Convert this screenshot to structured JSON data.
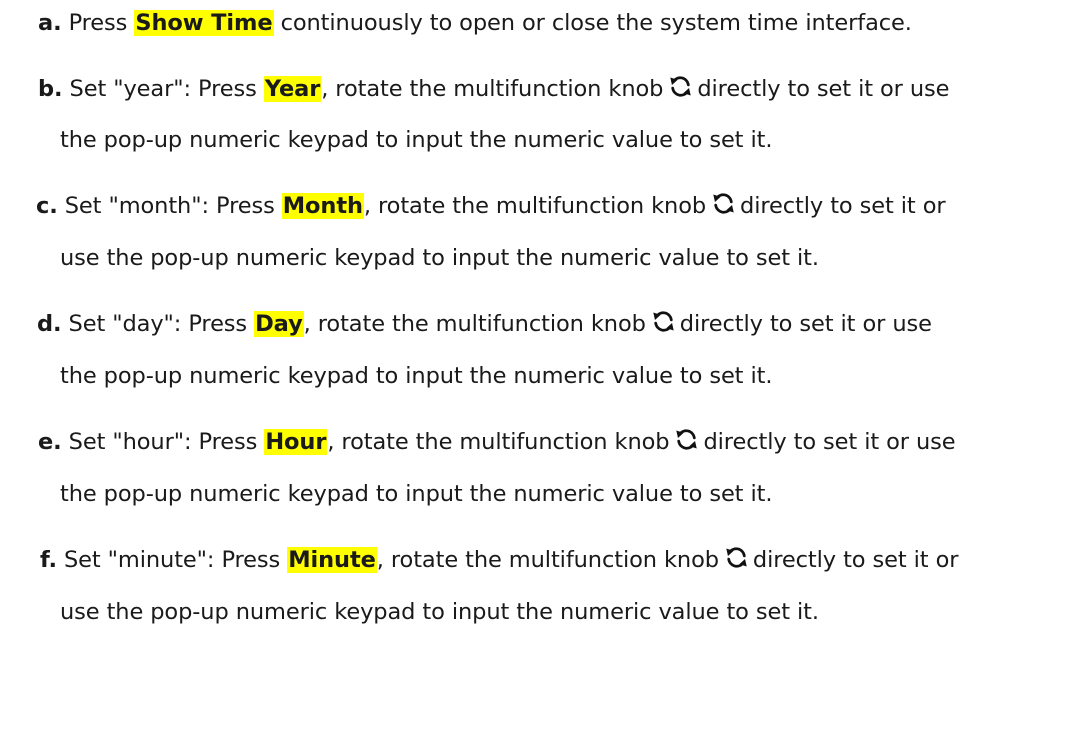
{
  "steps": [
    {
      "letter": "a.",
      "text_before": " Press ",
      "key": "Show Time",
      "text_after": " continuously to open or close the system time interface."
    },
    {
      "letter": "b.",
      "text_before": " Set \"year\": Press ",
      "key": "Year",
      "text_mid": ", rotate the multifunction knob",
      "text_after": "directly to set it or use",
      "line2": "the pop-up numeric keypad to input the numeric value to set it."
    },
    {
      "letter": "c.",
      "text_before": " Set \"month\": Press ",
      "key": "Month",
      "text_mid": ", rotate the multifunction knob",
      "text_after": "directly to set it or",
      "line2": "use the pop-up numeric keypad to input the numeric value to set it."
    },
    {
      "letter": "d.",
      "text_before": " Set \"day\": Press ",
      "key": "Day",
      "text_mid": ", rotate the multifunction knob",
      "text_after": "directly to set it or use",
      "line2": "the pop-up numeric keypad to input the numeric value to set it."
    },
    {
      "letter": "e.",
      "text_before": " Set \"hour\": Press ",
      "key": "Hour",
      "text_mid": ", rotate the multifunction knob",
      "text_after": "directly to set it or use",
      "line2": "the pop-up numeric keypad to input the numeric value to set it."
    },
    {
      "letter": "f.",
      "text_before": " Set \"minute\": Press ",
      "key": "Minute",
      "text_mid": ", rotate the multifunction knob",
      "text_after": "directly to set it or",
      "line2": "use the pop-up numeric keypad to input the numeric value to set it."
    }
  ],
  "icon": "rotate-knob-icon",
  "highlight_color": "#ffff00"
}
